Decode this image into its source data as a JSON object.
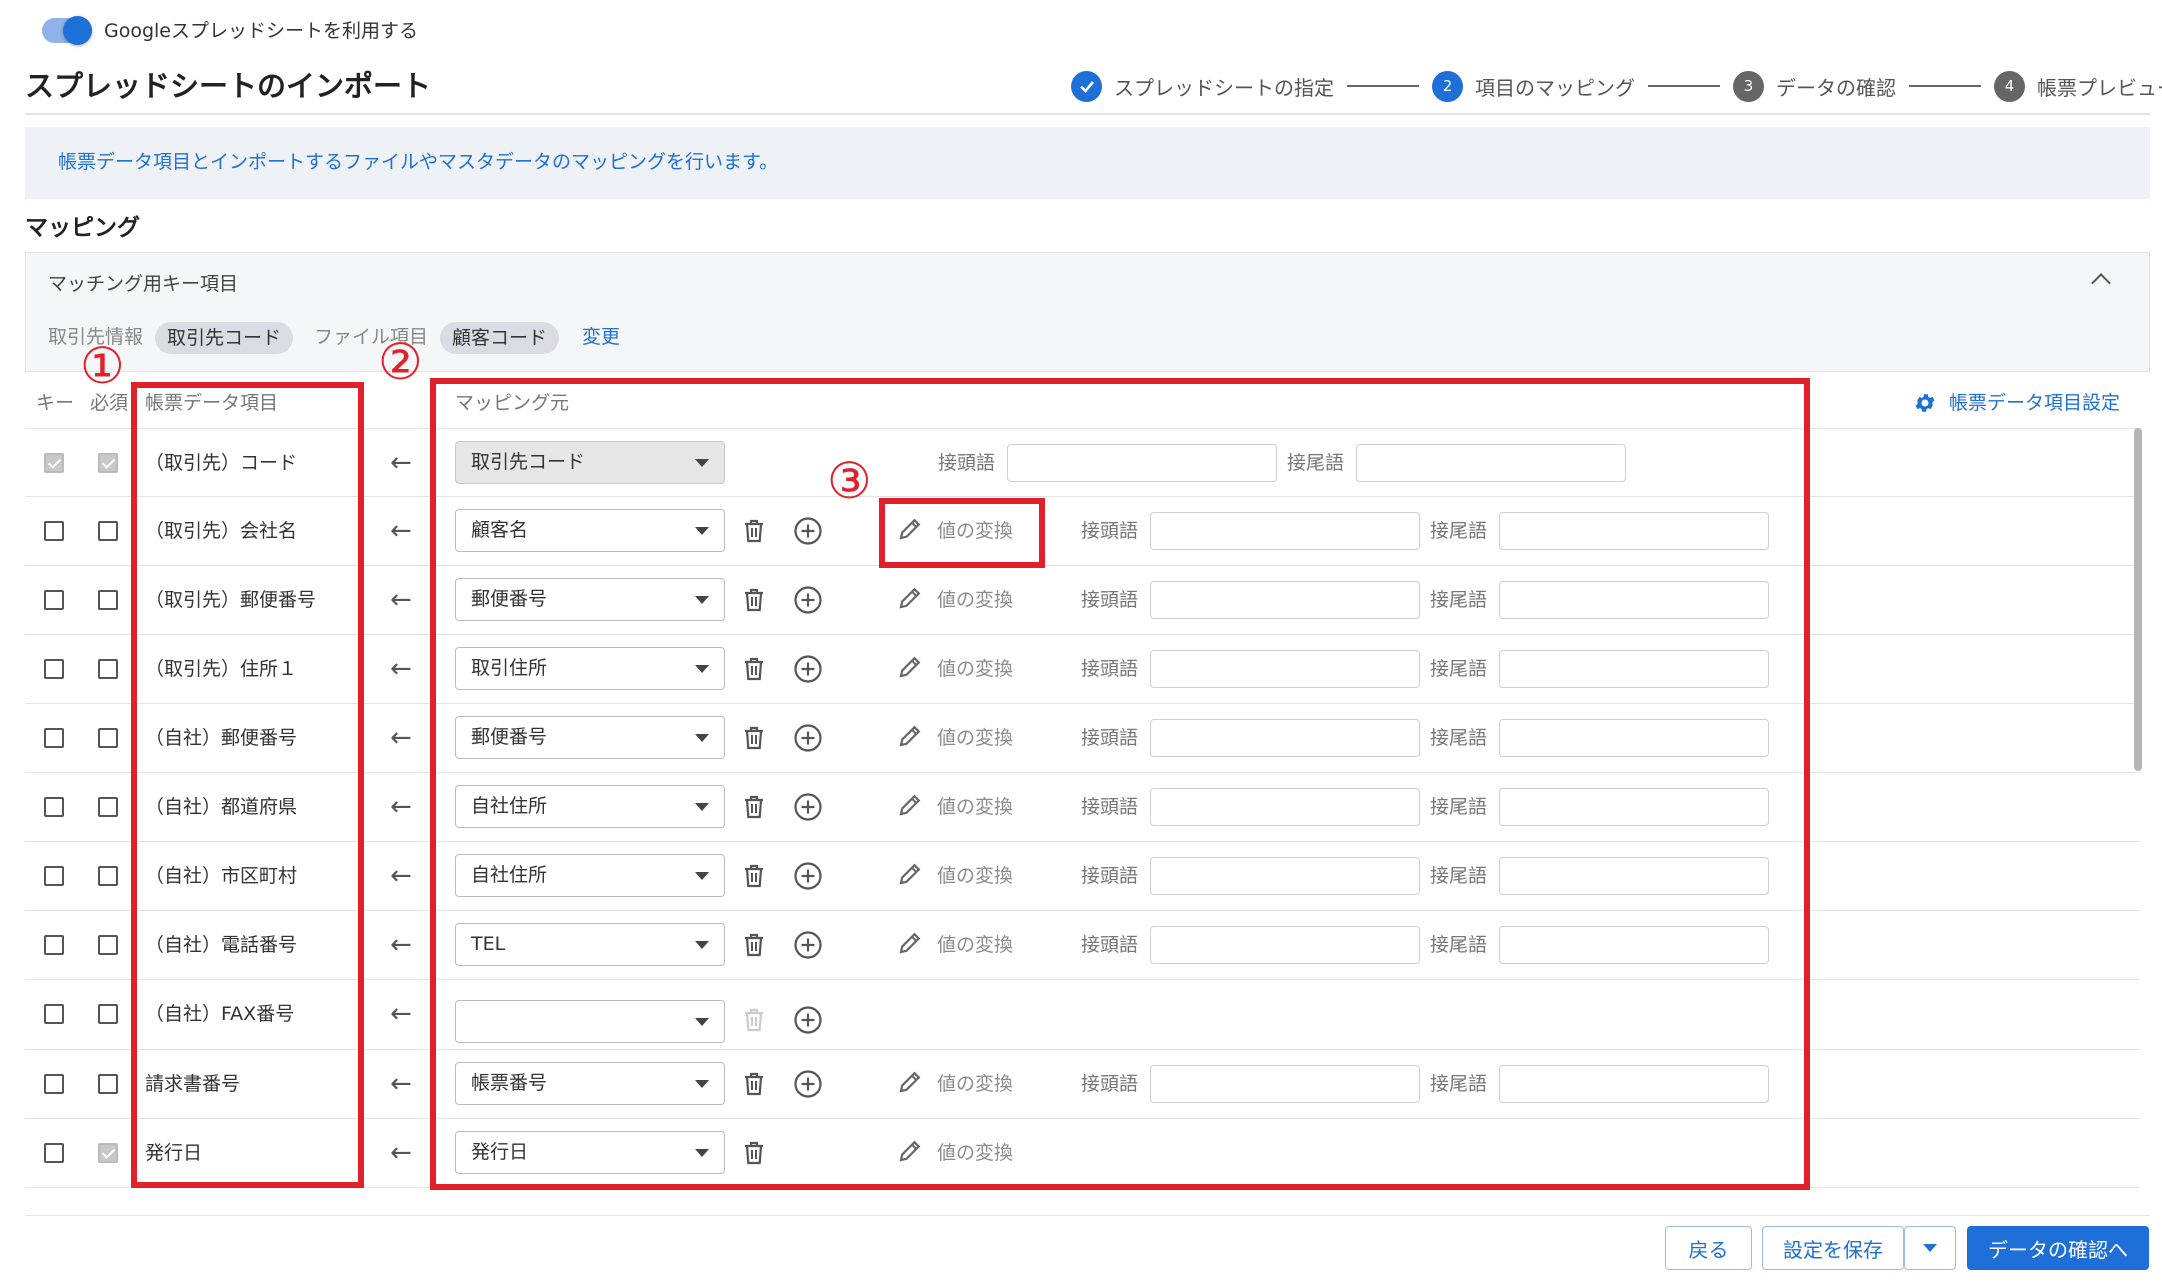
{
  "header": {
    "toggle_label": "Googleスプレッドシートを利用する",
    "title": "スプレッドシートのインポート",
    "steps": [
      {
        "number": "✓",
        "label": "スプレッドシートの指定",
        "state": "done"
      },
      {
        "number": "2",
        "label": "項目のマッピング",
        "state": "current"
      },
      {
        "number": "3",
        "label": "データの確認",
        "state": "todo"
      },
      {
        "number": "4",
        "label": "帳票プレビュー",
        "state": "todo"
      }
    ]
  },
  "info": {
    "text": "帳票データ項目とインポートするファイルやマスタデータのマッピングを行います。"
  },
  "mapping": {
    "section_title": "マッピング",
    "key_panel": {
      "title": "マッチング用キー項目",
      "partner_label": "取引先情報",
      "partner_chip": "取引先コード",
      "file_label": "ファイル項目",
      "file_chip": "顧客コード",
      "change_link": "変更"
    },
    "columns": {
      "key": "キー",
      "required": "必須",
      "field": "帳票データ項目",
      "source": "マッピング元"
    },
    "settings_link": "帳票データ項目設定",
    "convert_label": "値の変換",
    "prefix_label": "接頭語",
    "suffix_label": "接尾語",
    "rows": [
      {
        "field": "（取引先）コード",
        "source": "取引先コード"
      },
      {
        "field": "（取引先）会社名",
        "source": "顧客名"
      },
      {
        "field": "（取引先）郵便番号",
        "source": "郵便番号"
      },
      {
        "field": "（取引先）住所１",
        "source": "取引住所"
      },
      {
        "field": "（自社）郵便番号",
        "source": "郵便番号"
      },
      {
        "field": "（自社）都道府県",
        "source": "自社住所"
      },
      {
        "field": "（自社）市区町村",
        "source": "自社住所"
      },
      {
        "field": "（自社）電話番号",
        "source": "TEL"
      },
      {
        "field": "（自社）FAX番号",
        "source": ""
      },
      {
        "field": "請求書番号",
        "source": "帳票番号"
      },
      {
        "field": "発行日",
        "source": "発行日"
      }
    ]
  },
  "annotations": {
    "one": "①",
    "two": "②",
    "three": "③",
    "color": "#e0212b"
  },
  "footer": {
    "back": "戻る",
    "save": "設定を保存",
    "next": "データの確認へ"
  },
  "colors": {
    "accent": "#1f6fd8",
    "annotation": "#e0212b"
  }
}
